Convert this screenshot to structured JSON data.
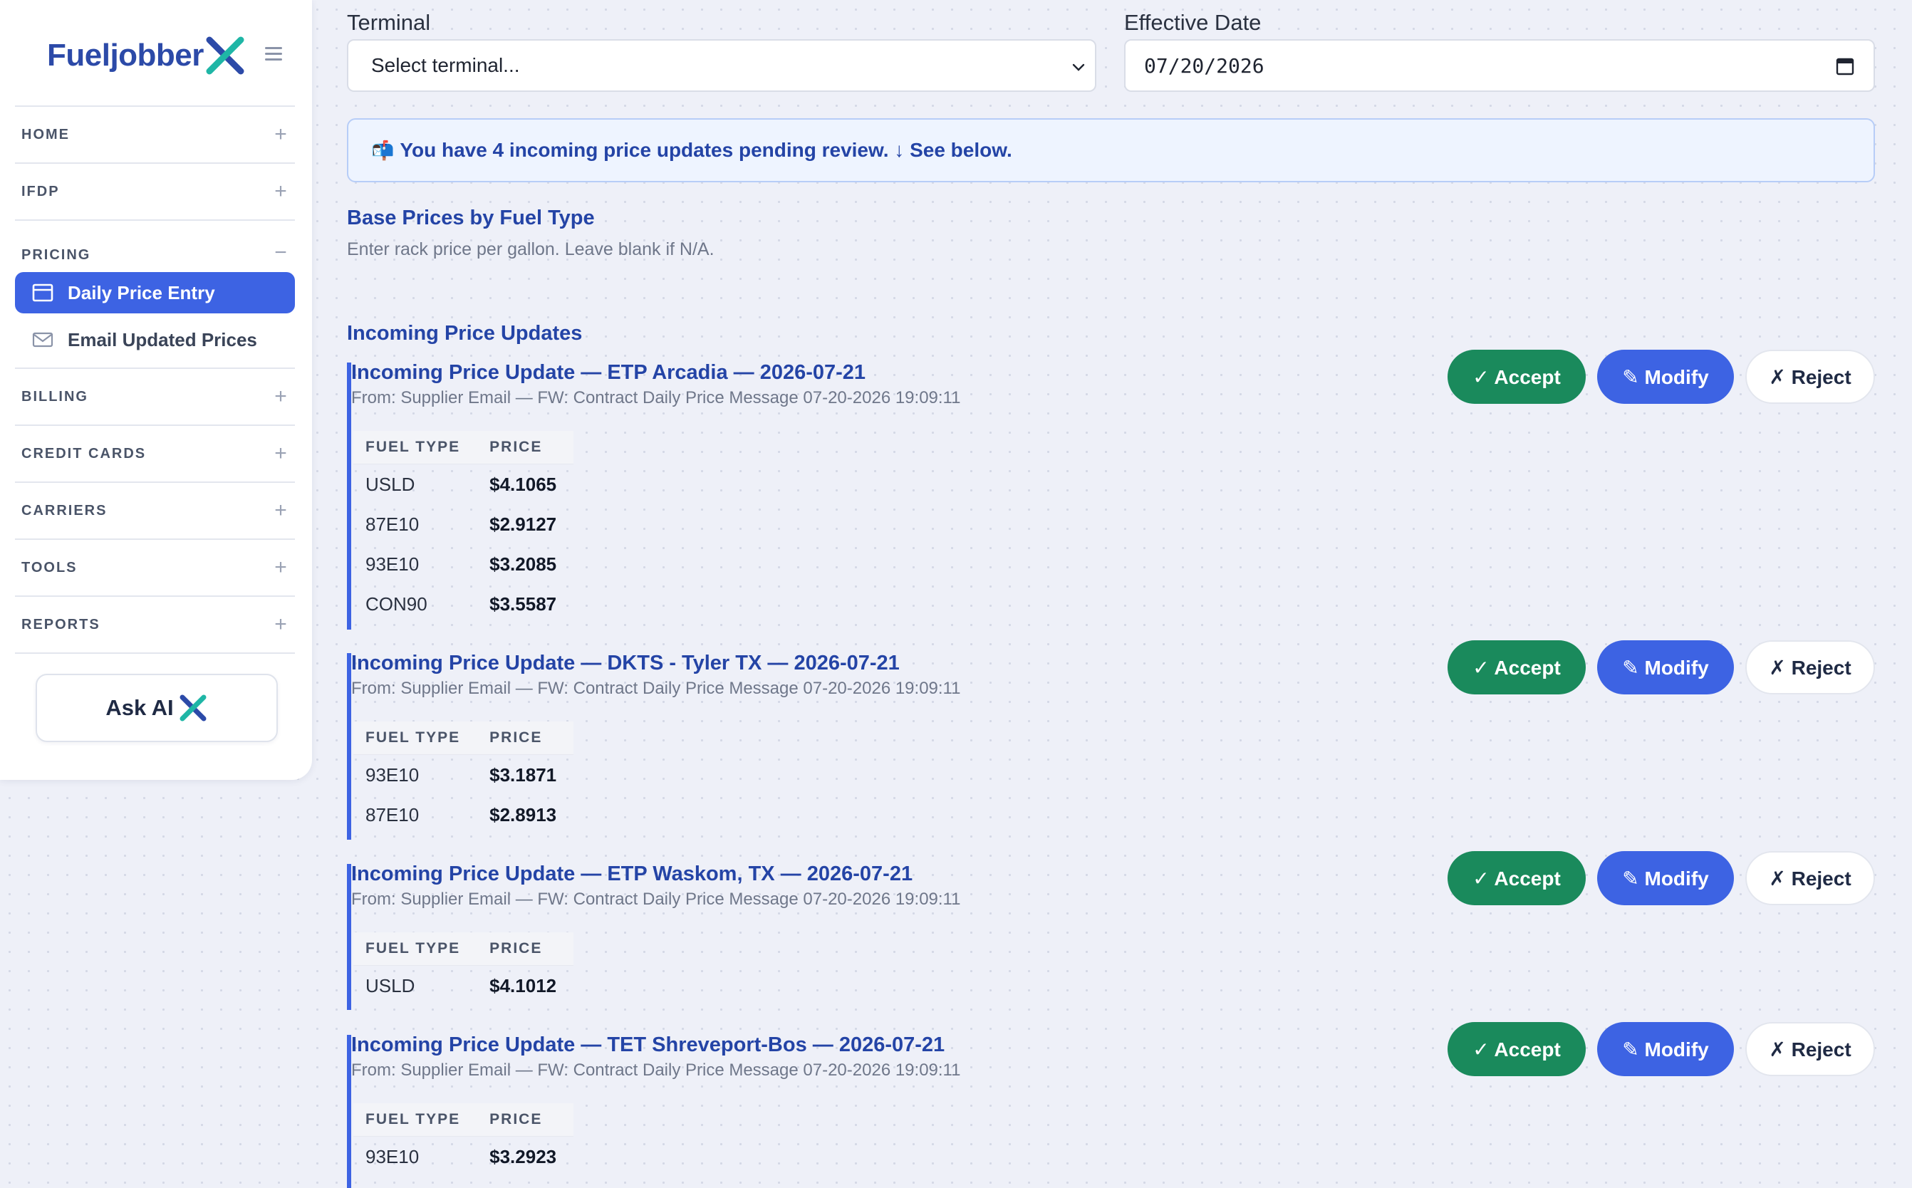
{
  "brand": {
    "name": "Fueljobber",
    "accent": "#2c4aa8",
    "x_colors": [
      "#2c4aa8",
      "#1fb6a6"
    ]
  },
  "sidebar": {
    "sections": [
      {
        "label": "HOME",
        "state": "collapsed"
      },
      {
        "label": "IFDP",
        "state": "collapsed"
      },
      {
        "label": "PRICING",
        "state": "expanded"
      },
      {
        "label": "BILLING",
        "state": "collapsed"
      },
      {
        "label": "CREDIT CARDS",
        "state": "collapsed"
      },
      {
        "label": "CARRIERS",
        "state": "collapsed"
      },
      {
        "label": "TOOLS",
        "state": "collapsed"
      },
      {
        "label": "REPORTS",
        "state": "collapsed"
      }
    ],
    "pricing_items": [
      {
        "label": "Daily Price Entry",
        "icon": "calendar-icon",
        "active": true
      },
      {
        "label": "Email Updated Prices",
        "icon": "mail-icon",
        "active": false
      }
    ],
    "ask_ai_label": "Ask AI"
  },
  "form": {
    "terminal_label": "Terminal",
    "terminal_value": "Select terminal...",
    "date_label": "Effective Date",
    "date_value": "07/20/2026"
  },
  "alert": {
    "icon": "📬",
    "text": "You have 4 incoming price updates pending review. ↓ See below."
  },
  "base_prices": {
    "title": "Base Prices by Fuel Type",
    "subtitle": "Enter rack price per gallon. Leave blank if N/A."
  },
  "incoming": {
    "title": "Incoming Price Updates",
    "col_fuel": "FUEL TYPE",
    "col_price": "PRICE",
    "accept_label": "✓ Accept",
    "modify_label": "✎ Modify",
    "reject_label": "✗ Reject",
    "updates": [
      {
        "title": "Incoming Price Update — ETP Arcadia — 2026-07-21",
        "from": "From: Supplier Email — FW: Contract Daily Price Message 07-20-2026 19:09:11",
        "rows": [
          {
            "fuel": "USLD",
            "price": "$4.1065"
          },
          {
            "fuel": "87E10",
            "price": "$2.9127"
          },
          {
            "fuel": "93E10",
            "price": "$3.2085"
          },
          {
            "fuel": "CON90",
            "price": "$3.5587"
          }
        ]
      },
      {
        "title": "Incoming Price Update — DKTS - Tyler TX — 2026-07-21",
        "from": "From: Supplier Email — FW: Contract Daily Price Message 07-20-2026 19:09:11",
        "rows": [
          {
            "fuel": "93E10",
            "price": "$3.1871"
          },
          {
            "fuel": "87E10",
            "price": "$2.8913"
          }
        ]
      },
      {
        "title": "Incoming Price Update — ETP Waskom, TX — 2026-07-21",
        "from": "From: Supplier Email — FW: Contract Daily Price Message 07-20-2026 19:09:11",
        "rows": [
          {
            "fuel": "USLD",
            "price": "$4.1012"
          }
        ]
      },
      {
        "title": "Incoming Price Update — TET Shreveport-Bos — 2026-07-21",
        "from": "From: Supplier Email — FW: Contract Daily Price Message 07-20-2026 19:09:11",
        "rows": [
          {
            "fuel": "93E10",
            "price": "$3.2923"
          }
        ]
      }
    ]
  }
}
